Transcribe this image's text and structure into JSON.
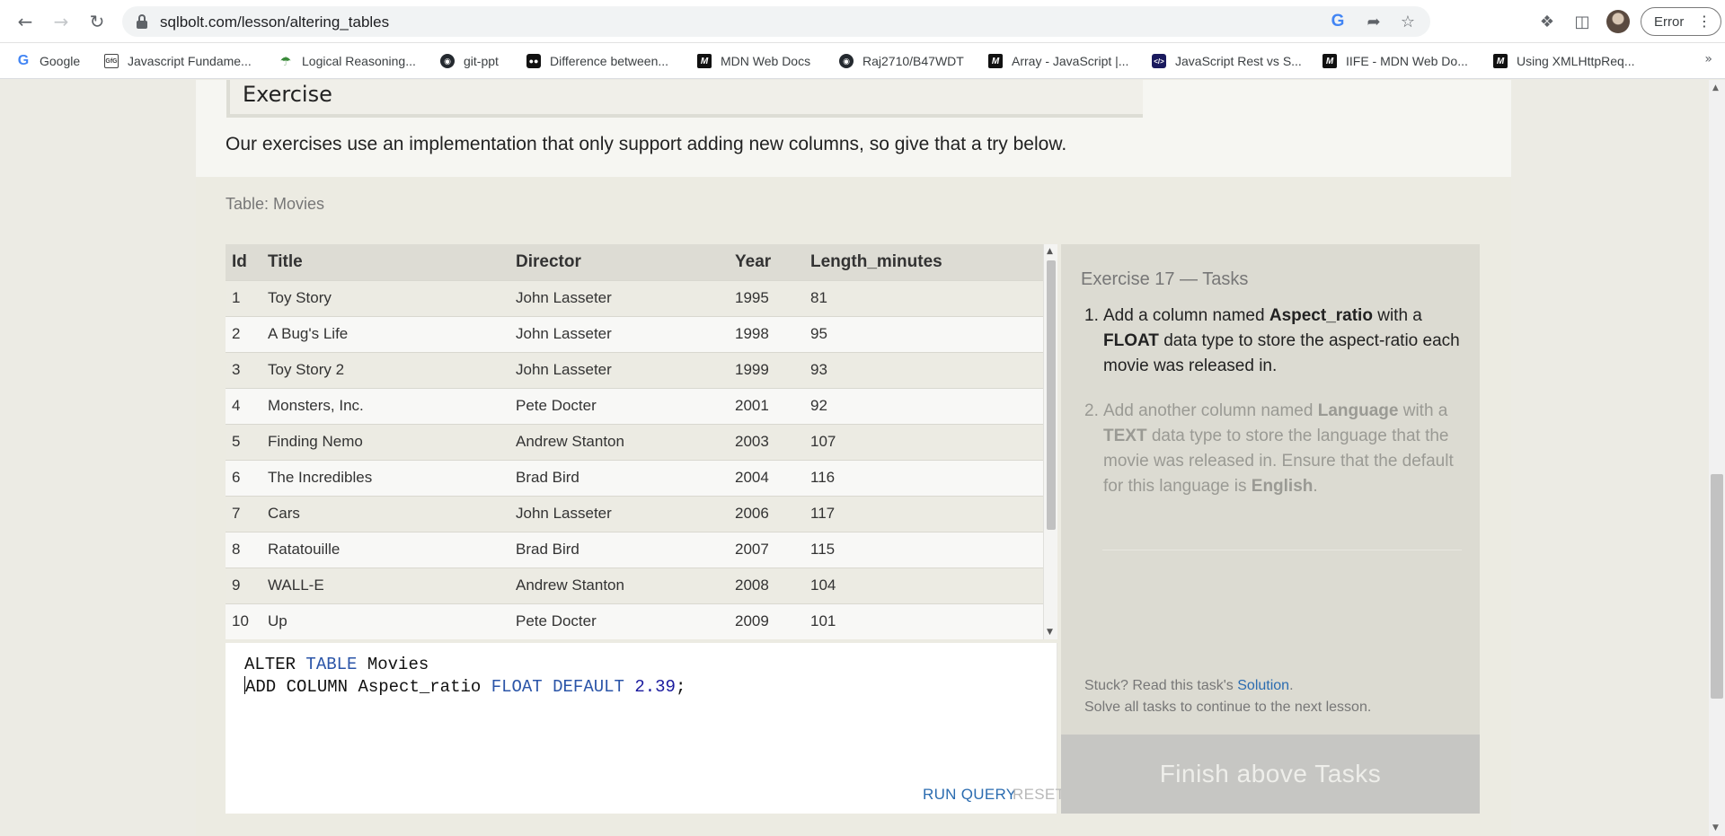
{
  "browser": {
    "url": "sqlbolt.com/lesson/altering_tables",
    "profile_status": "Error",
    "icons": {
      "back": "back-arrow-icon",
      "forward": "forward-arrow-icon",
      "reload": "reload-icon",
      "lock": "lock-icon",
      "google_lens": "google-icon",
      "share": "share-icon",
      "bookmark_star": "star-icon",
      "extensions": "puzzle-icon",
      "side_panel": "side-panel-icon",
      "menu": "kebab-menu-icon"
    }
  },
  "bookmarks": [
    {
      "label": "Google",
      "icon": "google-icon"
    },
    {
      "label": "Javascript Fundame...",
      "icon": "geeksforgeeks-icon"
    },
    {
      "label": "Logical Reasoning...",
      "icon": "umbrella-icon"
    },
    {
      "label": "git-ppt",
      "icon": "github-icon"
    },
    {
      "label": "Difference between...",
      "icon": "medium-icon"
    },
    {
      "label": "MDN Web Docs",
      "icon": "mdn-icon"
    },
    {
      "label": "Raj2710/B47WDT",
      "icon": "github-icon"
    },
    {
      "label": "Array - JavaScript |...",
      "icon": "mdn-icon"
    },
    {
      "label": "JavaScript Rest vs S...",
      "icon": "js-icon"
    },
    {
      "label": "IIFE - MDN Web Do...",
      "icon": "mdn-icon"
    },
    {
      "label": "Using XMLHttpReq...",
      "icon": "mdn-icon"
    }
  ],
  "lesson": {
    "exercise_heading": "Exercise",
    "intro": "Our exercises use an implementation that only support adding new columns, so give that a try below.",
    "table_caption": "Table: Movies",
    "columns": [
      "Id",
      "Title",
      "Director",
      "Year",
      "Length_minutes"
    ],
    "rows": [
      [
        "1",
        "Toy Story",
        "John Lasseter",
        "1995",
        "81"
      ],
      [
        "2",
        "A Bug's Life",
        "John Lasseter",
        "1998",
        "95"
      ],
      [
        "3",
        "Toy Story 2",
        "John Lasseter",
        "1999",
        "93"
      ],
      [
        "4",
        "Monsters, Inc.",
        "Pete Docter",
        "2001",
        "92"
      ],
      [
        "5",
        "Finding Nemo",
        "Andrew Stanton",
        "2003",
        "107"
      ],
      [
        "6",
        "The Incredibles",
        "Brad Bird",
        "2004",
        "116"
      ],
      [
        "7",
        "Cars",
        "John Lasseter",
        "2006",
        "117"
      ],
      [
        "8",
        "Ratatouille",
        "Brad Bird",
        "2007",
        "115"
      ],
      [
        "9",
        "WALL-E",
        "Andrew Stanton",
        "2008",
        "104"
      ],
      [
        "10",
        "Up",
        "Pete Docter",
        "2009",
        "101"
      ]
    ]
  },
  "editor": {
    "line1": {
      "kw1": "ALTER",
      "kw2": "TABLE",
      "name": "Movies"
    },
    "line2": {
      "kw1": "ADD",
      "kw2": "COLUMN",
      "name": "Aspect_ratio",
      "type": "FLOAT",
      "kw3": "DEFAULT",
      "value": "2.39",
      "end": ";"
    },
    "run_label": "RUN QUERY",
    "reset_label": "RESET"
  },
  "tasks": {
    "title": "Exercise 17 — Tasks",
    "items": [
      {
        "number": "1.",
        "parts": [
          "Add a column named ",
          "Aspect_ratio",
          " with a ",
          "FLOAT",
          " data type to store the aspect-ratio each movie was released in."
        ],
        "state": "active"
      },
      {
        "number": "2.",
        "parts": [
          "Add another column named ",
          "Language",
          " with a ",
          "TEXT",
          " data type to store the language that the movie was released in. Ensure that the default for this language is ",
          "English",
          "."
        ],
        "state": "pending"
      }
    ],
    "stuck_prefix": "Stuck? Read this task's ",
    "solution_link": "Solution",
    "stuck_suffix": ".",
    "continue_note": "Solve all tasks to continue to the next lesson.",
    "finish_label": "Finish above Tasks"
  },
  "colors": {
    "keyword": "#2b55a8",
    "number": "#1a1a9e",
    "link": "#2b6cb0",
    "finish_button_bg": "#c6c6c3"
  }
}
